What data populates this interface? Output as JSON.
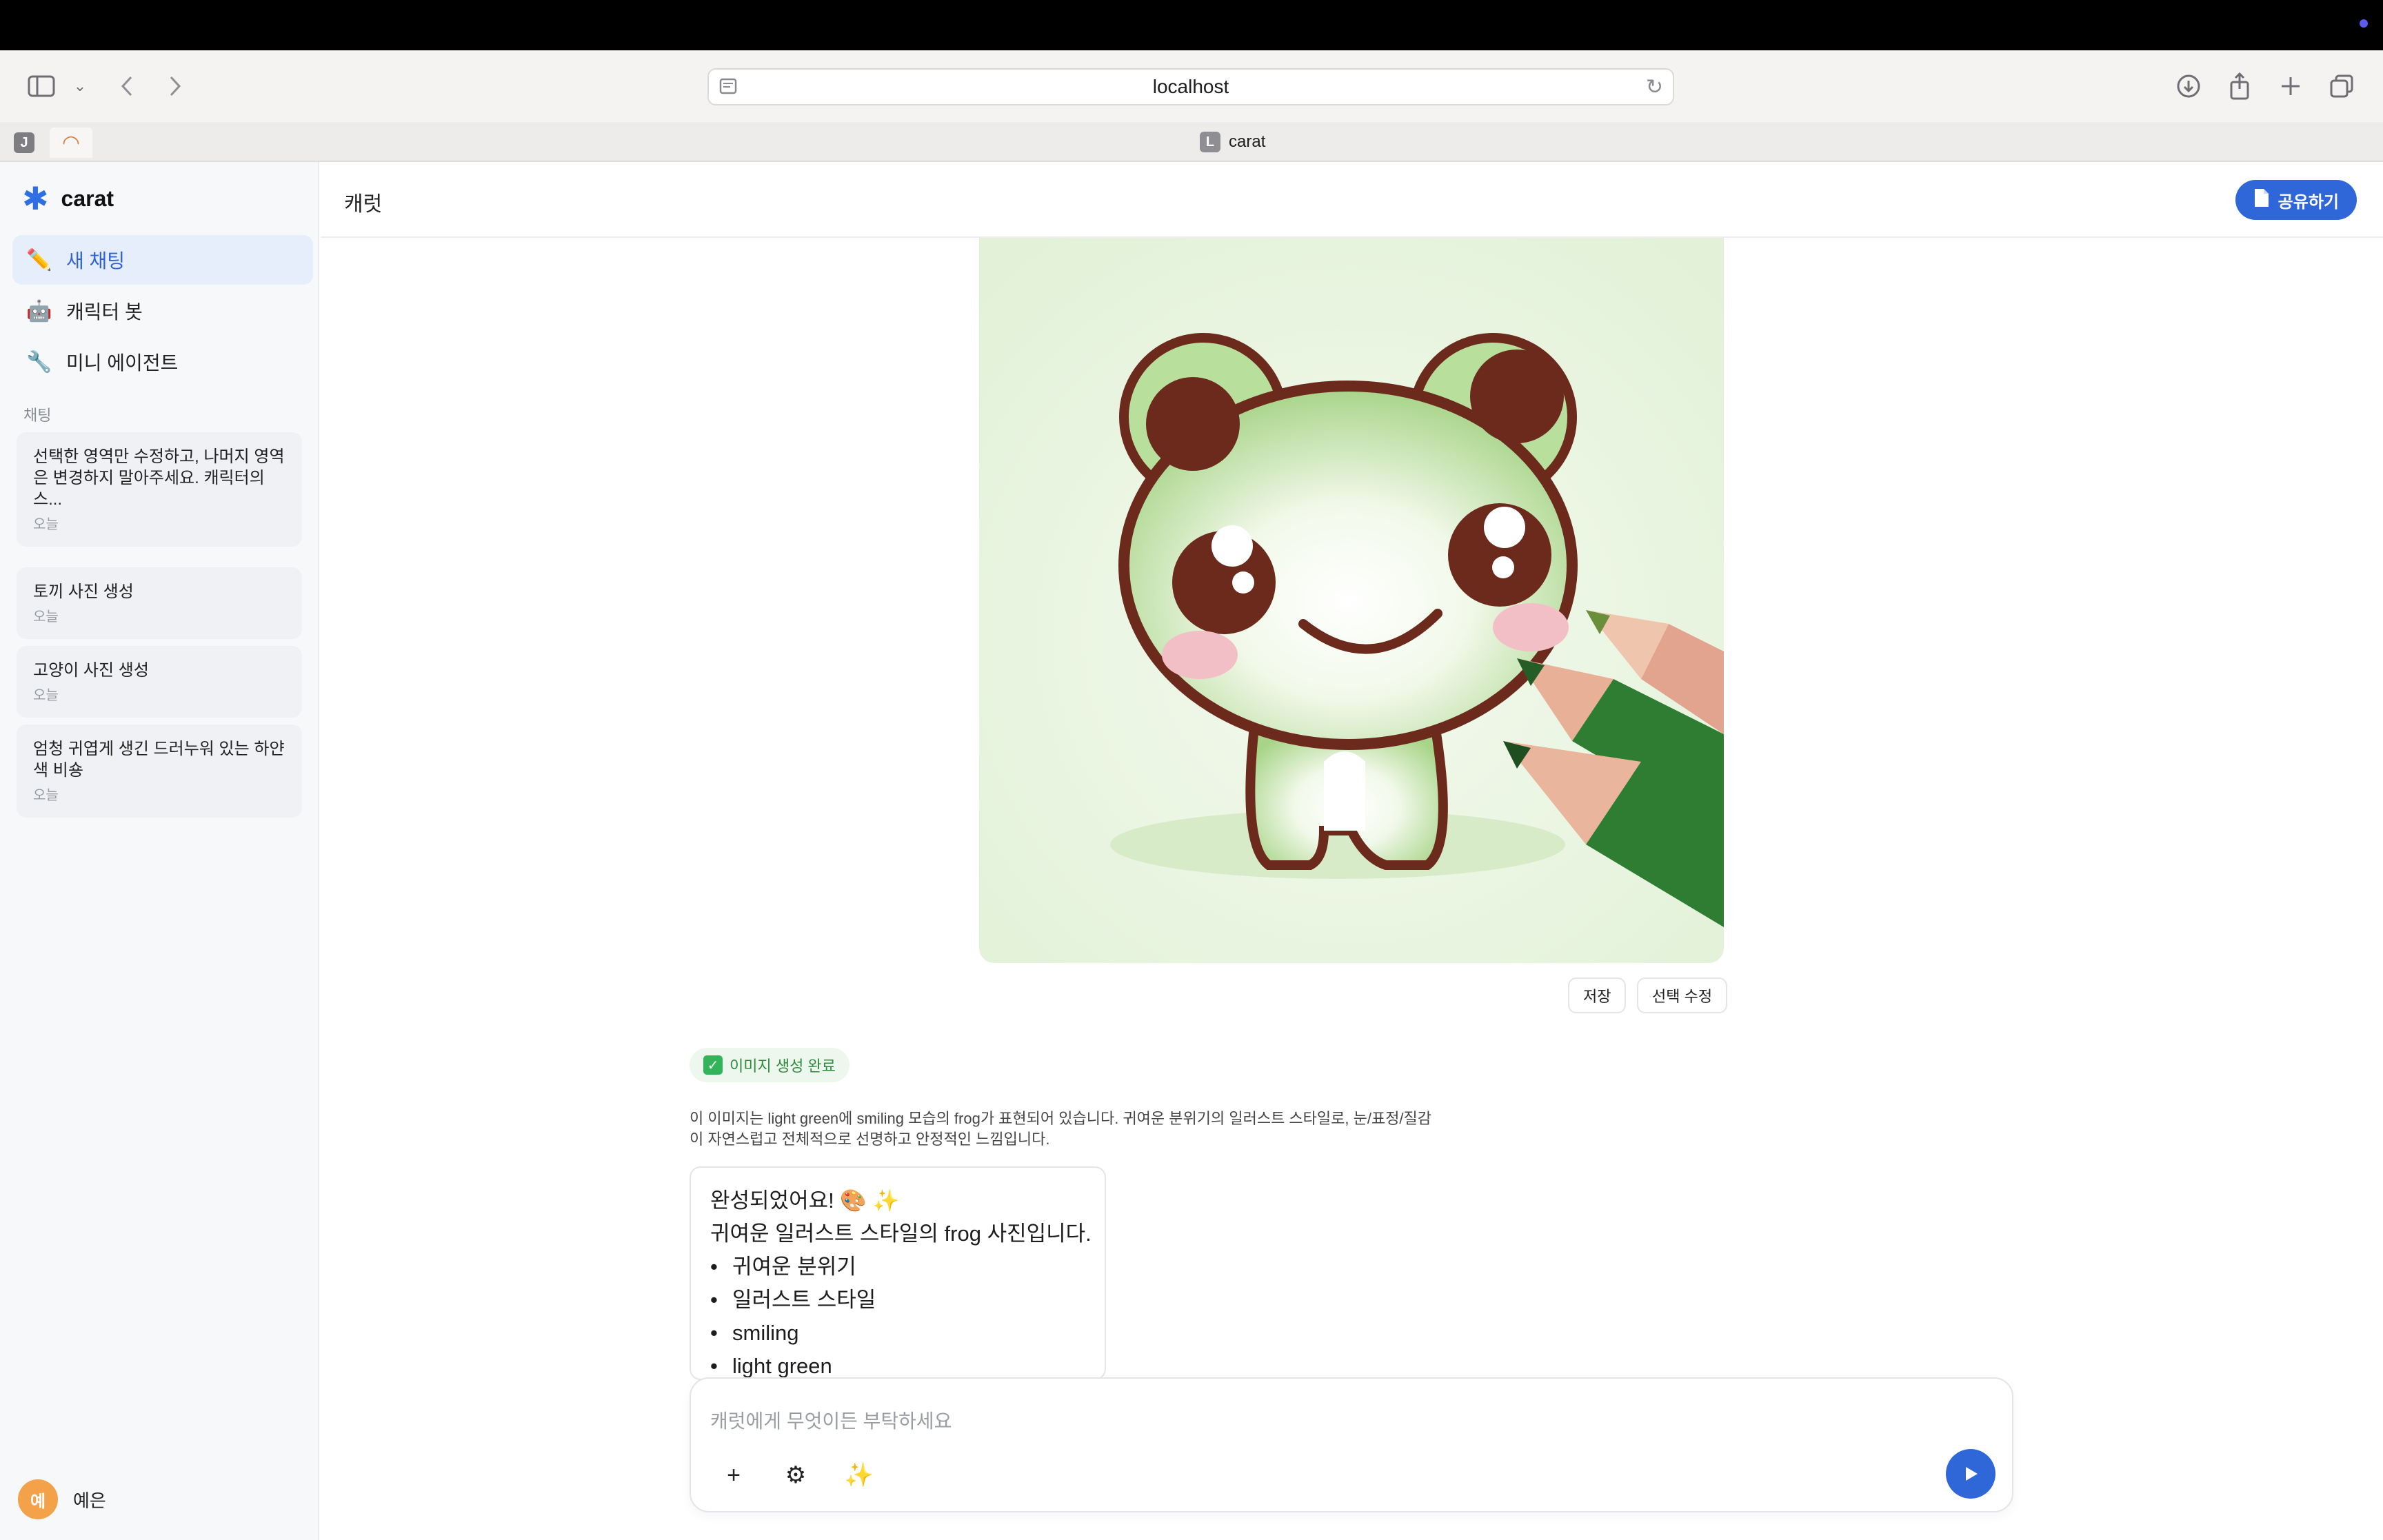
{
  "browser": {
    "url": "localhost",
    "pinned_tab_1": "J",
    "active_tab_title": "carat",
    "active_tab_favicon": "L"
  },
  "sidebar": {
    "brand": "carat",
    "nav": [
      {
        "label": "새 채팅",
        "icon": "pencil-icon",
        "active": true
      },
      {
        "label": "캐릭터 봇",
        "icon": "robot-icon",
        "active": false
      },
      {
        "label": "미니 에이전트",
        "icon": "wrench-icon",
        "active": false
      }
    ],
    "section_label": "채팅",
    "chats": [
      {
        "title": "선택한 영역만 수정하고, 나머지 영역은 변경하지 말아주세요. 캐릭터의 스...",
        "date": "오늘"
      },
      {
        "title": "토끼 사진 생성",
        "date": "오늘"
      },
      {
        "title": "고양이 사진 생성",
        "date": "오늘"
      },
      {
        "title": "엄청 귀엽게 생긴 드러누워 있는 하얀색 비숑",
        "date": "오늘"
      }
    ],
    "user": {
      "avatar": "예",
      "name": "예은"
    }
  },
  "header": {
    "title": "캐럿",
    "share_label": "공유하기"
  },
  "message": {
    "image_alt": "frog illustration",
    "save_label": "저장",
    "edit_label": "선택 수정",
    "status": "이미지 생성 완료",
    "description": "이 이미지는 light green에 smiling 모습의 frog가 표현되어 있습니다. 귀여운 분위기의 일러스트 스타일로, 눈/표정/질감이 자연스럽고 전체적으로 선명하고 안정적인 느낌입니다.",
    "reply_line1": "완성되었어요! 🎨 ✨",
    "reply_line2": "귀여운 일러스트 스타일의 frog 사진입니다.",
    "reply_bullets": [
      "귀여운 분위기",
      "일러스트 스타일",
      "smiling",
      "light green"
    ]
  },
  "composer": {
    "placeholder": "캐럿에게 무엇이든 부탁하세요"
  },
  "colors": {
    "accent": "#2f67d8",
    "success": "#2d8a3e"
  }
}
